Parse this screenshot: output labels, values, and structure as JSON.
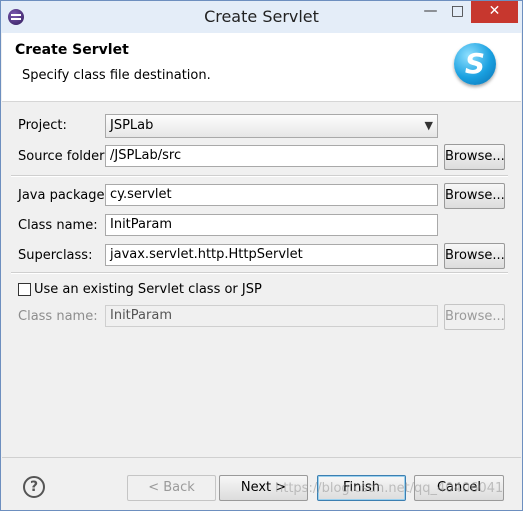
{
  "window": {
    "title": "Create Servlet",
    "min": "—",
    "max": "□",
    "close": "✕"
  },
  "header": {
    "title": "Create Servlet",
    "subtitle": "Specify class file destination.",
    "logo": "S"
  },
  "form": {
    "project_label": "Project:",
    "project_value": "JSPLab",
    "source_folder_label": "Source folder:",
    "source_folder_value": "/JSPLab/src",
    "java_package_label": "Java package:",
    "java_package_value": "cy.servlet",
    "class_name_label": "Class name:",
    "class_name_value": "InitParam",
    "superclass_label": "Superclass:",
    "superclass_value": "javax.servlet.http.HttpServlet",
    "browse_label": "Browse...",
    "use_existing_label": "Use an existing Servlet class or JSP",
    "existing_class_name_label": "Class name:",
    "existing_class_name_value": "InitParam"
  },
  "footer": {
    "help": "?",
    "back": "< Back",
    "next": "Next >",
    "finish": "Finish",
    "cancel": "Cancel",
    "watermark": "https://blog.csdn.net/qq_40406041"
  }
}
